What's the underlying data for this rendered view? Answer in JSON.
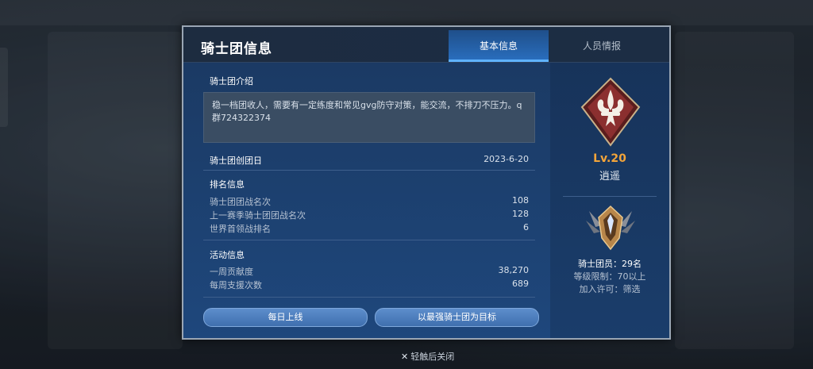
{
  "dialog": {
    "title": "骑士团信息",
    "tabs": [
      {
        "label": "基本信息",
        "active": true
      },
      {
        "label": "人员情报",
        "active": false
      }
    ]
  },
  "intro": {
    "heading": "骑士团介绍",
    "text": "稳一档团收人，需要有一定练度和常见gvg防守对策，能交流，不排刀不压力。q群724322374"
  },
  "founded": {
    "label": "骑士团创团日",
    "date": "2023-6-20"
  },
  "ranking": {
    "heading": "排名信息",
    "rows": [
      {
        "label": "骑士团团战名次",
        "value": "108"
      },
      {
        "label": "上一赛季骑士团团战名次",
        "value": "128"
      },
      {
        "label": "世界首领战排名",
        "value": "6"
      }
    ]
  },
  "activity": {
    "heading": "活动信息",
    "rows": [
      {
        "label": "一周贡献度",
        "value": "38,270"
      },
      {
        "label": "每周支援次数",
        "value": "689"
      }
    ]
  },
  "buttons": {
    "daily": "每日上线",
    "goal": "以最强骑士团为目标"
  },
  "guild": {
    "level": "Lv.20",
    "name": "逍遥",
    "members": "骑士团员：29名",
    "level_limit": "等级限制：70以上",
    "join_permission": "加入许可：筛选"
  },
  "footer": {
    "close_hint": "轻触后关闭"
  },
  "colors": {
    "accent": "#2a6fc0",
    "level": "#f2a43a",
    "emblem": "#8b2f2f"
  }
}
